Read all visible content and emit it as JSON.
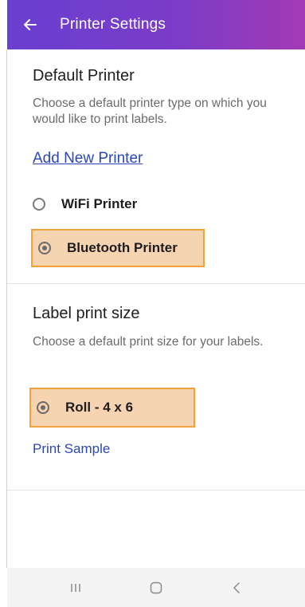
{
  "app_bar": {
    "title": "Printer Settings",
    "back_icon": "arrow-left-icon"
  },
  "default_printer": {
    "title": "Default Printer",
    "description": "Choose a default printer type on which you would like to print labels.",
    "add_link": "Add New Printer",
    "options": [
      {
        "label": "WiFi Printer",
        "selected": false
      },
      {
        "label": "Bluetooth Printer",
        "selected": true
      }
    ]
  },
  "label_print_size": {
    "title": "Label print size",
    "description": "Choose a default print size for your labels.",
    "options": [
      {
        "label": "Roll - 4 x 6",
        "selected": true
      }
    ],
    "sample_link": "Print Sample"
  },
  "nav_bar": {
    "recents_icon": "recents-icon",
    "home_icon": "home-icon",
    "back_icon": "back-chevron-icon"
  },
  "colors": {
    "header_start": "#6a3fd1",
    "header_end": "#a33ab4",
    "link": "#2a47b4",
    "highlight_fill": "#f6d3b1",
    "highlight_border": "#f0a33b"
  }
}
